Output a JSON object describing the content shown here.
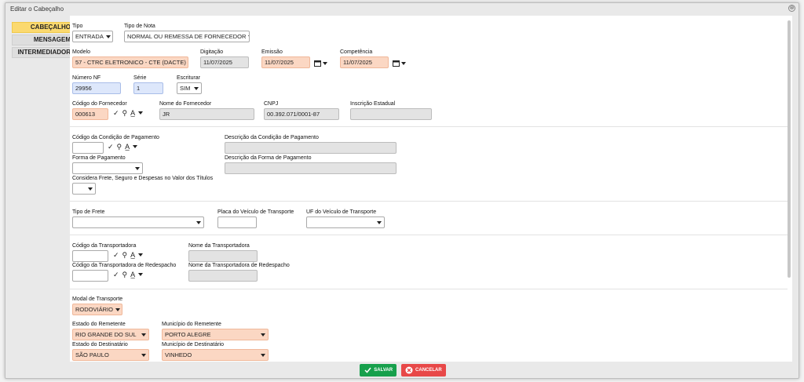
{
  "modal": {
    "title": "Editar o Cabeçalho",
    "close_glyph": "⊗"
  },
  "tabs": [
    {
      "label": "CABEÇALHO",
      "active": true
    },
    {
      "label": "MENSAGEM",
      "active": false
    },
    {
      "label": "INTERMEDIADOR",
      "active": false
    }
  ],
  "fields": {
    "tipo": {
      "label": "Tipo",
      "value": "ENTRADA"
    },
    "tipo_nota": {
      "label": "Tipo de Nota",
      "value": "NORMAL OU REMESSA DE FORNECEDOR"
    },
    "modelo": {
      "label": "Modelo",
      "value": "57 - CTRC ELETRONICO - CTE (DACTE)"
    },
    "digitacao": {
      "label": "Digitação",
      "value": "11/07/2025"
    },
    "emissao": {
      "label": "Emissão",
      "value": "11/07/2025"
    },
    "competencia": {
      "label": "Competência",
      "value": "11/07/2025"
    },
    "numero_nf": {
      "label": "Número NF",
      "value": "29956"
    },
    "serie": {
      "label": "Série",
      "value": "1"
    },
    "escriturar": {
      "label": "Escriturar",
      "value": "SIM"
    },
    "cod_fornecedor": {
      "label": "Código do Fornecedor",
      "value": "000613"
    },
    "nome_fornecedor": {
      "label": "Nome do Fornecedor",
      "value": "JR"
    },
    "cnpj": {
      "label": "CNPJ",
      "value": "00.392.071/0001-87"
    },
    "inscricao_estadual": {
      "label": "Inscrição Estadual",
      "value": ""
    },
    "cod_cond_pagamento": {
      "label": "Código da Condição de Pagamento",
      "value": ""
    },
    "desc_cond_pagamento": {
      "label": "Descrição da Condição de Pagamento",
      "value": ""
    },
    "forma_pagamento": {
      "label": "Forma de Pagamento",
      "value": ""
    },
    "desc_forma_pagamento": {
      "label": "Descrição da Forma de Pagamento",
      "value": ""
    },
    "considera_frete": {
      "label": "Considera Frete, Seguro e Despesas no Valor dos Títulos",
      "value": ""
    },
    "tipo_frete": {
      "label": "Tipo de Frete",
      "value": ""
    },
    "placa_veiculo": {
      "label": "Placa do Veículo de Transporte",
      "value": ""
    },
    "uf_veiculo": {
      "label": "UF do Veículo de Transporte",
      "value": ""
    },
    "cod_transportadora": {
      "label": "Código da Transportadora",
      "value": ""
    },
    "nome_transportadora": {
      "label": "Nome da Transportadora",
      "value": ""
    },
    "cod_transp_redespacho": {
      "label": "Código da Transportadora de Redespacho",
      "value": ""
    },
    "nome_transp_redespacho": {
      "label": "Nome da Transportadora de Redespacho",
      "value": ""
    },
    "modal_transporte": {
      "label": "Modal de Transporte",
      "value": "RODOVIÁRIO"
    },
    "estado_remetente": {
      "label": "Estado do Remetente",
      "value": "RIO GRANDE DO SUL"
    },
    "municipio_remetente": {
      "label": "Município do Remetente",
      "value": "PORTO ALEGRE"
    },
    "estado_destinatario": {
      "label": "Estado do Destinatário",
      "value": "SÃO PAULO"
    },
    "municipio_destinatario": {
      "label": "Município de Destinatário",
      "value": "VINHEDO"
    }
  },
  "footer": {
    "save_label": "SALVAR",
    "cancel_label": "CANCELAR"
  },
  "colors": {
    "active_tab": "#fbd96f",
    "required_field": "#fbd7c3",
    "numeric_field": "#dde7fb",
    "save": "#17a04c",
    "cancel": "#e84848"
  }
}
